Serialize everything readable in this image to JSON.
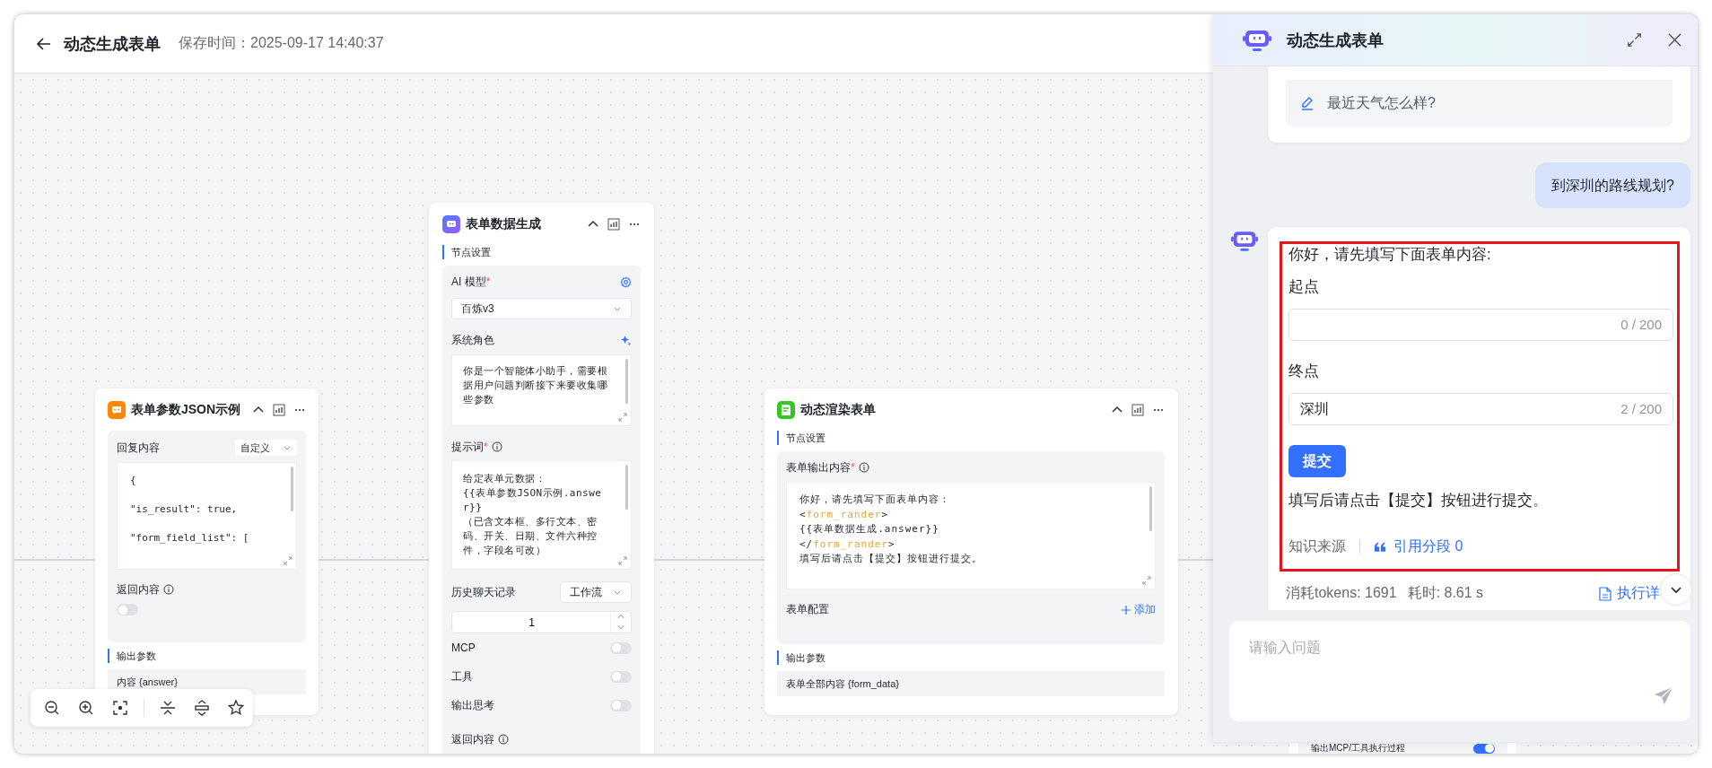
{
  "header": {
    "title": "动态生成表单",
    "saved": "保存时间：2025-09-17 14:40:37"
  },
  "reply_node": {
    "title": "表单参数JSON示例",
    "reply_label": "回复内容",
    "reply_mode": "自定义",
    "code_lines": [
      "{",
      "\"is_result\": true,",
      "\"form_field_list\": ["
    ],
    "return_label": "返回内容",
    "return_on": false,
    "output_title": "输出参数",
    "outputs": [
      "内容 {answer}"
    ]
  },
  "llm_node": {
    "title": "表单数据生成",
    "section": "节点设置",
    "model_label": "AI 模型",
    "model_mark": "*",
    "model": "百炼v3",
    "role_label": "系统角色",
    "role_text": "你是一个智能体小助手，需要根据用户问题判断接下来要收集哪些参数",
    "prompt_label": "提示词",
    "prompt_mark": "*",
    "prompt_lines": [
      "给定表单元数据：",
      "{{表单参数JSON示例.answer}}",
      "（已含文本框、多行文本、密码、开关、日期、文件六种控件，字段名可改）"
    ],
    "history_label": "历史聊天记录",
    "history_mode": "工作流",
    "history_count": "1",
    "switches": [
      {
        "label": "MCP",
        "on": false
      },
      {
        "label": "工具",
        "on": false
      },
      {
        "label": "输出思考",
        "on": false
      }
    ],
    "return_label": "返回内容"
  },
  "form_node": {
    "title": "动态渲染表单",
    "section": "节点设置",
    "content_label": "表单输出内容",
    "content_mark": "*",
    "content_lines": [
      [
        {
          "text": "你好，请先填写下面表单内容：",
          "kind": "plain"
        }
      ],
      [
        {
          "text": "<",
          "kind": "plain"
        },
        {
          "text": "form_rander",
          "kind": "tag"
        },
        {
          "text": ">",
          "kind": "plain"
        }
      ],
      [
        {
          "text": "{{表单数据生成.answer}}",
          "kind": "plain"
        }
      ],
      [
        {
          "text": "</",
          "kind": "plain"
        },
        {
          "text": "form_rander",
          "kind": "tag"
        },
        {
          "text": ">",
          "kind": "plain"
        }
      ],
      [
        {
          "text": "填写后请点击【提交】按钮进行提交。",
          "kind": "plain"
        }
      ]
    ],
    "config_label": "表单配置",
    "add_label": "添加",
    "output_title": "输出参数",
    "outputs": [
      "表单全部内容 {form_data}"
    ]
  },
  "hidden_node": {
    "switches": [
      {
        "label": "输出MCP/工具执行过程",
        "on": true
      }
    ]
  },
  "chat": {
    "title": "动态生成表单",
    "suggestion": "最近天气怎么样?",
    "user_message": "到深圳的路线规划?",
    "reply": {
      "highlighted": true,
      "intro": "你好，请先填写下面表单内容:",
      "fields": [
        {
          "label": "起点",
          "counter": "0 / 200"
        },
        {
          "label": "终点",
          "value": "深圳",
          "counter": "2 / 200"
        }
      ],
      "submit": "提交",
      "outro": "填写后请点击【提交】按钮进行提交。",
      "source_label": "知识来源",
      "citation": "引用分段 0"
    },
    "tokens": "消耗tokens: 1691",
    "duration": "耗时: 8.61 s",
    "details_link": "执行详",
    "input_placeholder": "请输入问题"
  }
}
